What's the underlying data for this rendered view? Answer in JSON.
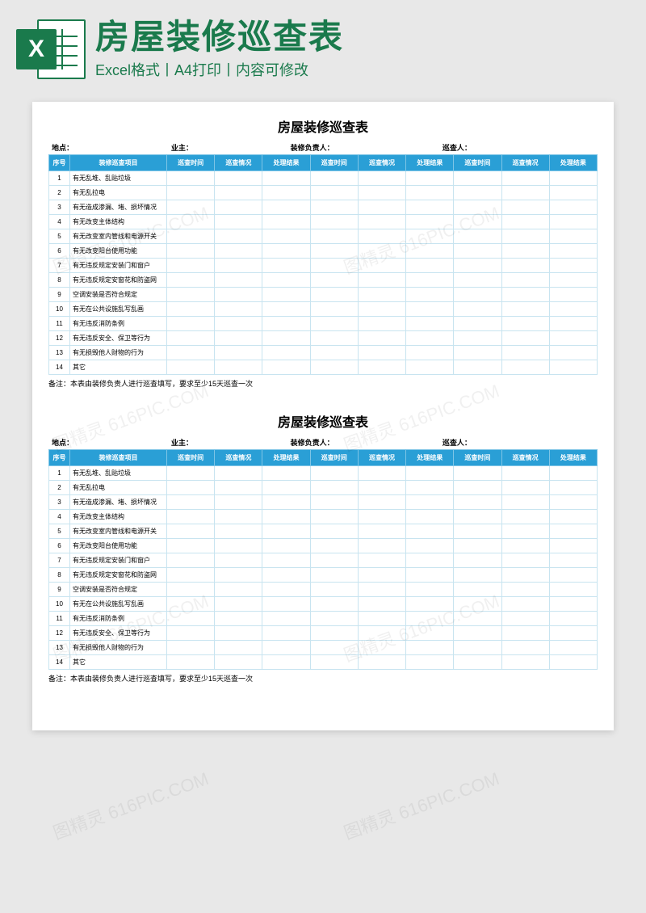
{
  "header": {
    "mainTitle": "房屋装修巡查表",
    "subTitle": "Excel格式丨A4打印丨内容可修改",
    "iconLetter": "X"
  },
  "form": {
    "title": "房屋装修巡查表",
    "infoLabels": [
      "地点：",
      "业主：",
      "装修负责人：",
      "巡查人："
    ],
    "columns": [
      "序号",
      "装修巡查项目",
      "巡查时间",
      "巡查情况",
      "处理结果",
      "巡查时间",
      "巡查情况",
      "处理结果",
      "巡查时间",
      "巡查情况",
      "处理结果"
    ],
    "rows": [
      "有无乱堆、乱贴垃圾",
      "有无乱拉电",
      "有无造成渗漏、堵、损坏情况",
      "有无改变主体结构",
      "有无改变室内管线和电源开关",
      "有无改变阳台使用功能",
      "有无违反规定安装门和窗户",
      "有无违反规定安窗花和防盗网",
      "空调安装是否符合规定",
      "有无在公共设施乱写乱画",
      "有无违反消防条例",
      "有无违反安全、保卫等行为",
      "有无损毁他人财物的行为",
      "其它"
    ],
    "noteLabel": "备注：",
    "noteText": "本表由装修负责人进行巡查填写，要求至少15天巡查一次"
  },
  "watermark": "图精灵 616PIC.COM"
}
